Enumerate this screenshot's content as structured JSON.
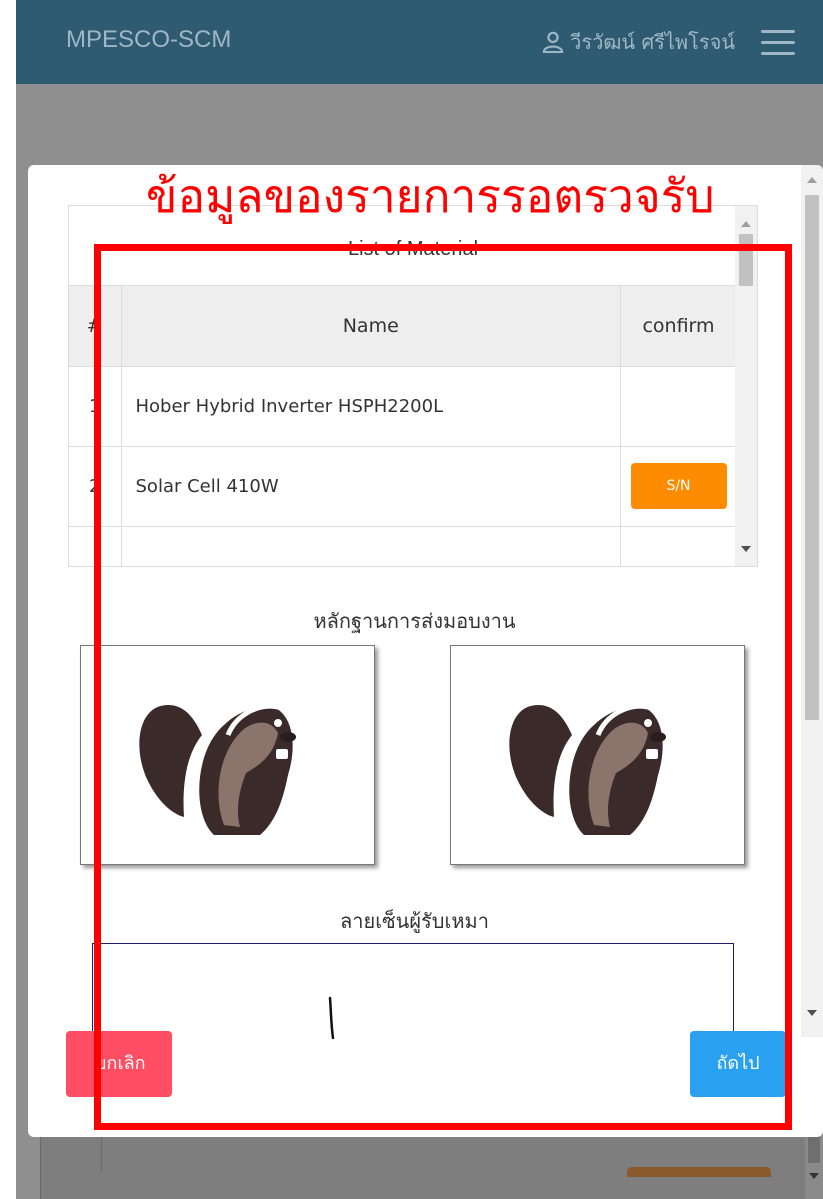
{
  "navbar": {
    "brand": "MPESCO-SCM",
    "user_name": "วีรวัฒน์ ศรีไพโรจน์",
    "user_icon": "user-icon",
    "menu_icon": "hamburger-menu-icon"
  },
  "annotation": {
    "title": "ข้อมูลของรายการรอตรวจรับ",
    "color": "#ff0000"
  },
  "material_table": {
    "title": "List of Material",
    "columns": [
      "#",
      "Name",
      "confirm"
    ],
    "rows": [
      {
        "num": "1",
        "name": "Hober Hybrid Inverter HSPH2200L",
        "confirm": ""
      },
      {
        "num": "2",
        "name": "Solar Cell 410W",
        "confirm": "S/N"
      }
    ]
  },
  "evidence": {
    "label": "หลักฐานการส่งมอบงาน",
    "photos": [
      "beaver-placeholder-image",
      "beaver-placeholder-image"
    ]
  },
  "signature": {
    "label": "ลายเซ็นผู้รับเหมา"
  },
  "buttons": {
    "cancel": "ยกเลิก",
    "next": "ถัดไป"
  },
  "colors": {
    "navbar": "#2e5a72",
    "sn_button": "#ff8c00",
    "cancel_button": "#ff4d64",
    "next_button": "#2aa0f0"
  }
}
